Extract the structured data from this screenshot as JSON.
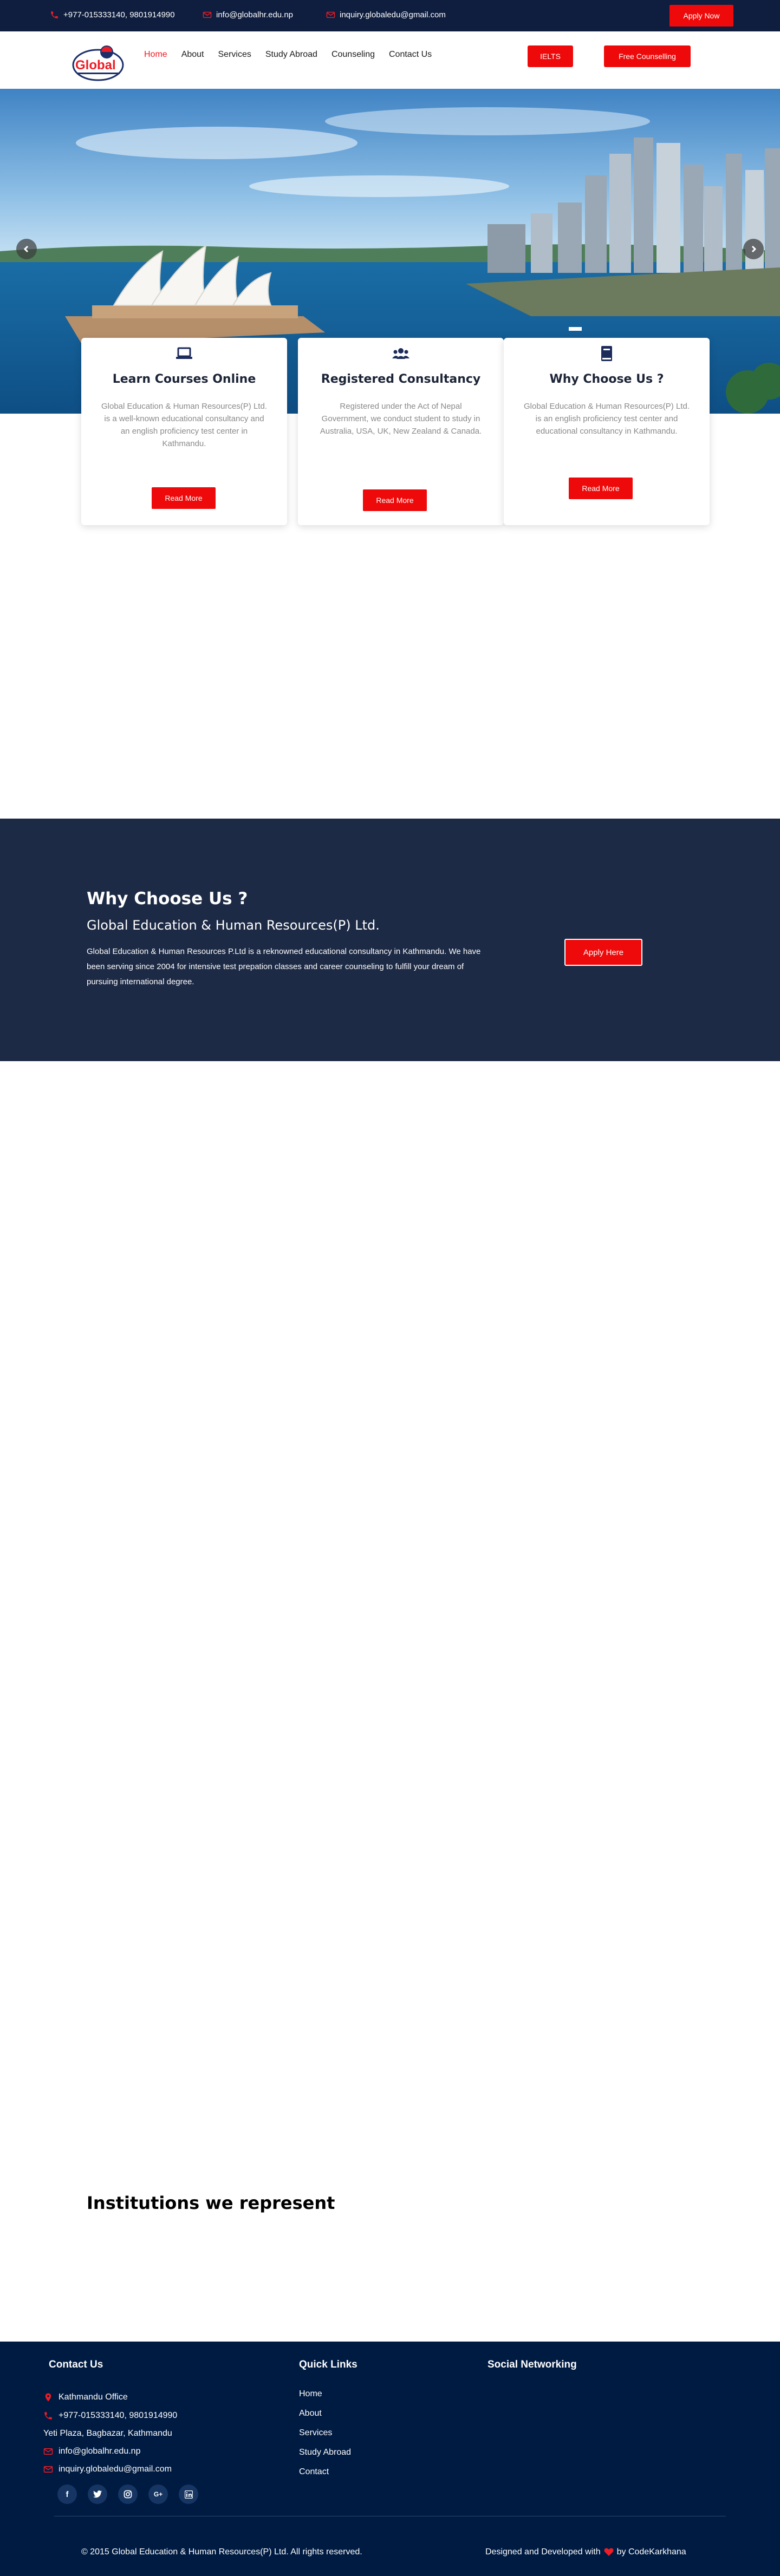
{
  "topbar": {
    "phone": "+977-015333140, 9801914990",
    "email": "info@globalhr.edu.np",
    "email2": "inquiry.globaledu@gmail.com",
    "apply_label": "Apply Now"
  },
  "header": {
    "logo_text": "Global",
    "nav": [
      "Home",
      "About",
      "Services",
      "Study Abroad",
      "Counseling",
      "Contact Us"
    ],
    "active_nav": "Home",
    "ielts_label": "IELTS",
    "counselling_label": "Free Counselling"
  },
  "cards": [
    {
      "icon": "laptop-icon",
      "title": "Learn Courses Online",
      "text": "Global Education & Human Resources(P) Ltd. is a well-known educational consultancy and an english proficiency test center in Kathmandu.",
      "button": "Read More"
    },
    {
      "icon": "users-icon",
      "title": "Registered Consultancy",
      "text": "Registered under the Act of Nepal Government, we conduct student to study in Australia, USA, UK, New Zealand & Canada.",
      "button": "Read More"
    },
    {
      "icon": "book-icon",
      "title": "Why Choose Us ?",
      "text": "Global Education & Human Resources(P) Ltd. is an english proficiency test center and educational consultancy in Kathmandu.",
      "button": "Read More"
    }
  ],
  "why": {
    "title": "Why Choose Us ?",
    "subtitle": "Global Education & Human Resources(P) Ltd.",
    "text": "Global Education & Human Resources P.Ltd is a reknowned educational consultancy in Kathmandu. We have been serving since 2004 for intensive test prepation classes and career counseling to fulfill your dream of pursuing international degree.",
    "button": "Apply Here"
  },
  "institutions": {
    "title": "Institutions we represent"
  },
  "footer": {
    "contact_title": "Contact Us",
    "office": "Kathmandu Office",
    "phone": "+977-015333140, 9801914990",
    "address": "Yeti Plaza, Bagbazar, Kathmandu",
    "email": "info@globalhr.edu.np",
    "email2": "inquiry.globaledu@gmail.com",
    "links_title": "Quick Links",
    "links": [
      "Home",
      "About",
      "Services",
      "Study Abroad",
      "Contact"
    ],
    "social_title": "Social Networking",
    "socials": [
      "facebook-icon",
      "twitter-icon",
      "instagram-icon",
      "google-plus-icon",
      "linkedin-icon"
    ],
    "copyright": "© 2015 Global Education & Human Resources(P) Ltd. All rights reserved.",
    "credit_prefix": "Designed and Developed with",
    "credit_suffix": "by CodeKarkhana"
  },
  "colors": {
    "navy": "#0f1e3f",
    "accent_red": "#ee0a0a",
    "section_navy": "#1d2a45",
    "footer_navy": "#001b42"
  }
}
